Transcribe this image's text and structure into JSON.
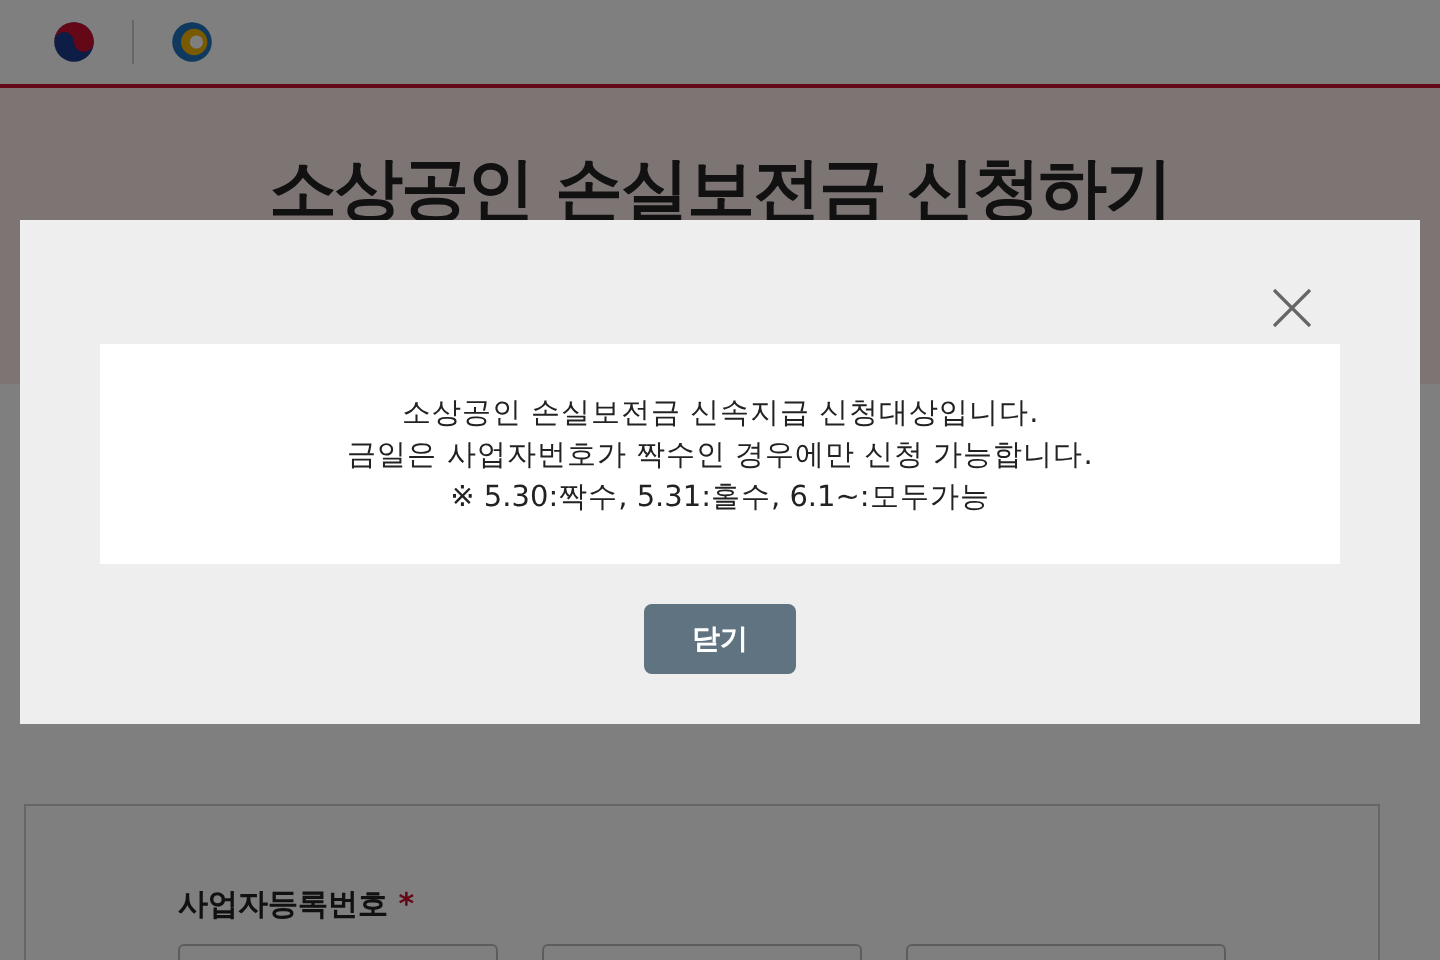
{
  "page": {
    "title": "소상공인 손실보전금 신청하기"
  },
  "form": {
    "field_label": "사업자등록번호",
    "required_mark": "*"
  },
  "dialog": {
    "lines": [
      "소상공인 손실보전금 신속지급 신청대상입니다.",
      "금일은 사업자번호가 짝수인 경우에만 신청 가능합니다.",
      "※ 5.30:짝수, 5.31:홀수, 6.1~:모두가능"
    ],
    "button": "닫기"
  }
}
